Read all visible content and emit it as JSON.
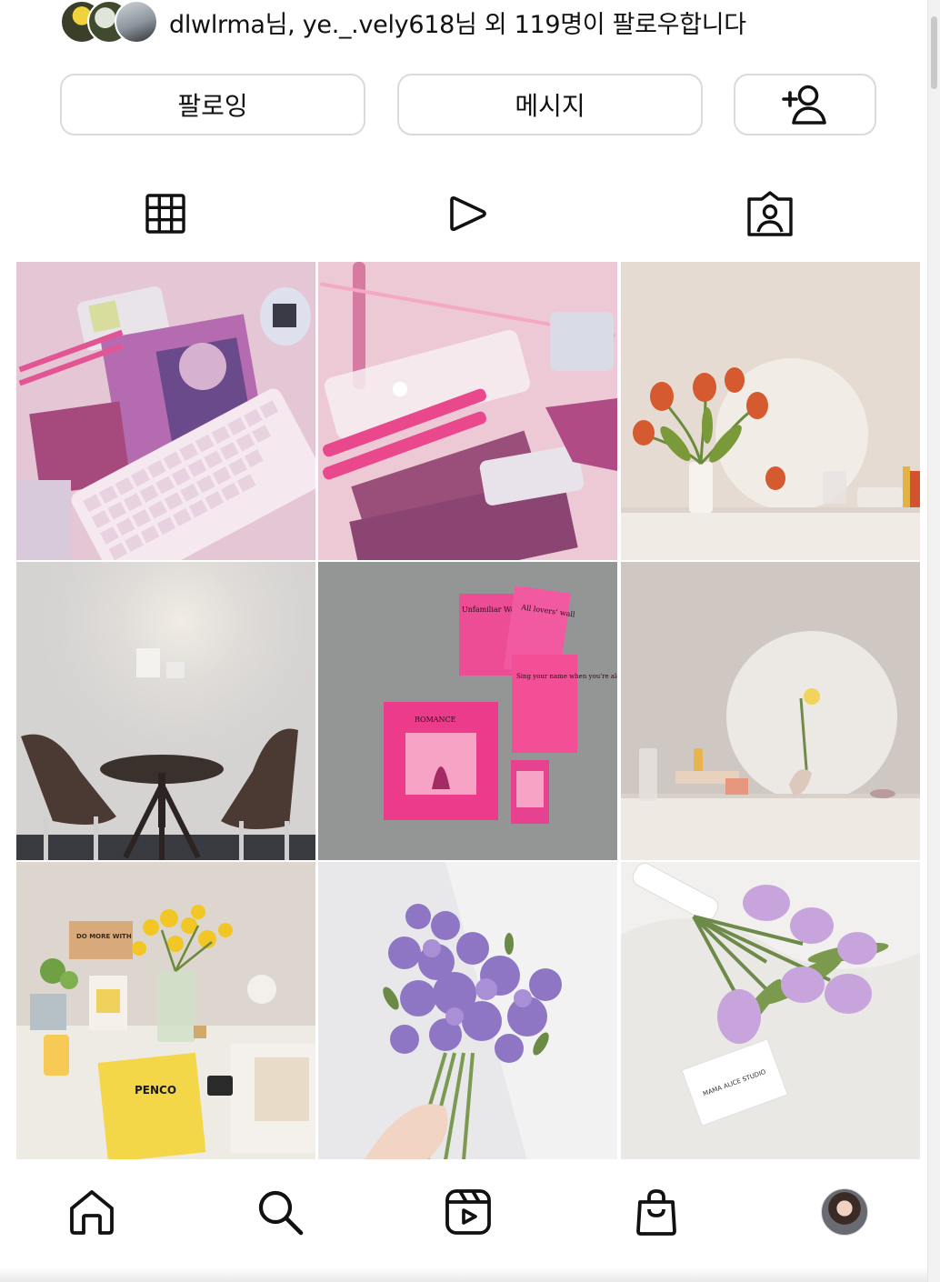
{
  "followers": {
    "text": "dlwlrma님, ye._.vely618님 외 119명이 팔로우합니다"
  },
  "actions": {
    "follow_label": "팔로잉",
    "message_label": "메시지",
    "add_person_icon": "add-person-icon"
  },
  "tabs": [
    {
      "icon": "grid-icon"
    },
    {
      "icon": "reels-play-icon"
    },
    {
      "icon": "tagged-person-icon"
    }
  ],
  "posts": [
    {
      "subject": "pink keyboard desk"
    },
    {
      "subject": "pink stationery"
    },
    {
      "subject": "tulips and round mirror"
    },
    {
      "subject": "cafe table and chairs"
    },
    {
      "subject": "pink book covers"
    },
    {
      "subject": "yellow rose and mirror"
    },
    {
      "subject": "yellow flowers desk"
    },
    {
      "subject": "purple lisianthus bouquet"
    },
    {
      "subject": "purple tulip bouquet"
    }
  ],
  "post_texts": {
    "book1": "Unfamiliar Waltz",
    "book2": "All lovers' wall",
    "book3": "Sing your name when you're alone at the beach",
    "book4": "ROMANCE",
    "notebook": "PENCO",
    "sign": "DO MORE WITH",
    "card": "MAMA ALICE STUDIO"
  },
  "bottom_nav": [
    {
      "icon": "home-icon"
    },
    {
      "icon": "search-icon"
    },
    {
      "icon": "reels-icon"
    },
    {
      "icon": "shop-bag-icon"
    },
    {
      "icon": "profile-avatar"
    }
  ]
}
